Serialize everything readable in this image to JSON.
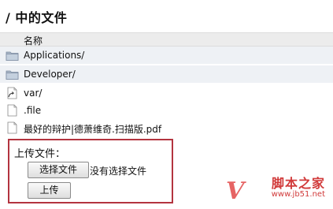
{
  "page": {
    "title": "/ 中的文件"
  },
  "file_list": {
    "column_header": "名称",
    "items": [
      {
        "name": "Applications/",
        "icon": "folder-icon"
      },
      {
        "name": "Developer/",
        "icon": "folder-icon"
      },
      {
        "name": "var/",
        "icon": "alias-folder-icon"
      },
      {
        "name": ".file",
        "icon": "file-icon"
      },
      {
        "name": "最好的辩护|德萧维奇.扫描版.pdf",
        "icon": "file-icon"
      }
    ]
  },
  "upload": {
    "label": "上传文件：",
    "choose_button": "选择文件",
    "no_file_text": "没有选择文件",
    "submit_button": "上传"
  },
  "watermark": {
    "main": "脚本之家",
    "sub": "www.jb51.net",
    "logo": "V"
  },
  "colors": {
    "highlight_border": "#b3343f",
    "watermark": "#d13a3a"
  }
}
